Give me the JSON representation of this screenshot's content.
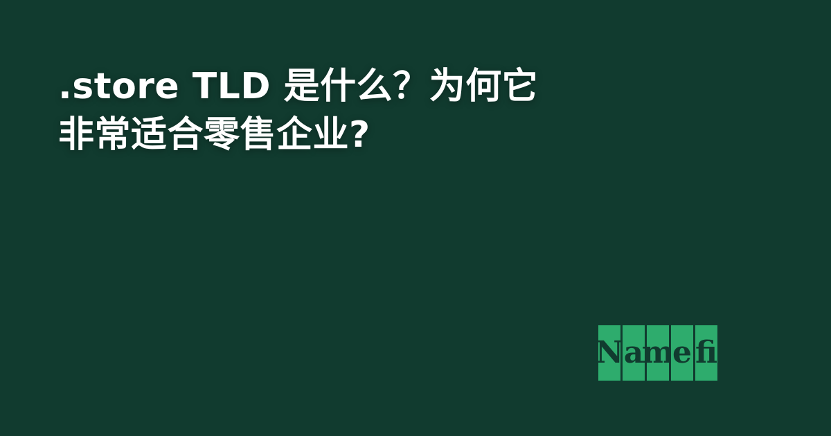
{
  "headline": {
    "line1": ".store TLD 是什么？为何它",
    "line2": "非常适合零售企业?"
  },
  "logo": {
    "letters": [
      "N",
      "a",
      "m",
      "e",
      "fi"
    ],
    "text": "Namefi",
    "tile_color": "#2eac6d",
    "letter_color": "#113b2f"
  },
  "background_color": "#113b2f"
}
